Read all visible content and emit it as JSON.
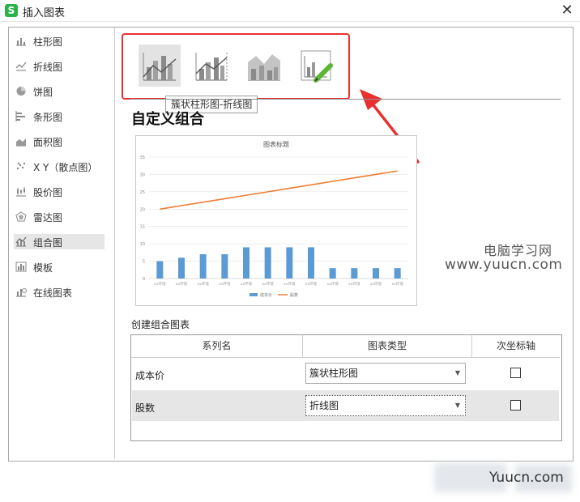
{
  "window": {
    "title": "插入图表",
    "app_icon_glyph": "S",
    "close_glyph": "✕"
  },
  "sidebar": {
    "items": [
      {
        "label": "柱形图",
        "icon": "column-chart-icon"
      },
      {
        "label": "折线图",
        "icon": "line-chart-icon"
      },
      {
        "label": "饼图",
        "icon": "pie-chart-icon"
      },
      {
        "label": "条形图",
        "icon": "bar-chart-icon"
      },
      {
        "label": "面积图",
        "icon": "area-chart-icon"
      },
      {
        "label": "X Y（散点图）",
        "icon": "scatter-chart-icon"
      },
      {
        "label": "股价图",
        "icon": "stock-chart-icon"
      },
      {
        "label": "雷达图",
        "icon": "radar-chart-icon"
      },
      {
        "label": "组合图",
        "icon": "combo-chart-icon",
        "active": true
      },
      {
        "label": "模板",
        "icon": "template-icon"
      },
      {
        "label": "在线图表",
        "icon": "online-chart-icon"
      }
    ]
  },
  "chart_types": {
    "tooltip": "簇状柱形图-折线图",
    "thumbnails": [
      "clustered-column-line-icon",
      "clustered-column-line-secondary-axis-icon",
      "stacked-area-column-icon",
      "custom-combo-icon"
    ],
    "selected_index": 0
  },
  "main": {
    "section_title": "自定义组合",
    "combo_title": "创建组合图表"
  },
  "chart_data": {
    "type": "bar",
    "title": "图表标题",
    "categories": [
      "xx环境",
      "xx环境",
      "xx环境",
      "xx环境",
      "xx环境",
      "xx环境",
      "xx环境",
      "xx环境",
      "xx环境",
      "xx环境",
      "xx环境",
      "xx环境"
    ],
    "ylim": [
      0,
      35
    ],
    "yticks": [
      0,
      5,
      10,
      15,
      20,
      25,
      30,
      35
    ],
    "grid": true,
    "legend": "bottom",
    "series": [
      {
        "name": "成本价",
        "type": "bar",
        "color": "#5b9bd5",
        "values": [
          5,
          6,
          7,
          7,
          9,
          9,
          9,
          9,
          3,
          3,
          3,
          3
        ]
      },
      {
        "name": "股数",
        "type": "line",
        "color": "#ed7d31",
        "values": [
          20,
          21,
          22,
          23,
          24,
          25,
          26,
          27,
          28,
          29,
          30,
          31
        ]
      }
    ]
  },
  "table": {
    "headers": [
      "系列名",
      "图表类型",
      "次坐标轴"
    ],
    "rows": [
      {
        "name": "成本价",
        "chart_type": "簇状柱形图",
        "secondary_axis": false
      },
      {
        "name": "股数",
        "chart_type": "折线图",
        "secondary_axis": false
      }
    ],
    "dropdown_glyph": "▼"
  },
  "watermark": {
    "line1": "电脑学习网",
    "line2": "www.yuucn.com",
    "footer": "Yuucn.com"
  },
  "colors": {
    "highlight": "#e8312f",
    "arrow": "#e8312f",
    "bar": "#5b9bd5",
    "line": "#ed7d31",
    "accent_green": "#5bb634"
  }
}
